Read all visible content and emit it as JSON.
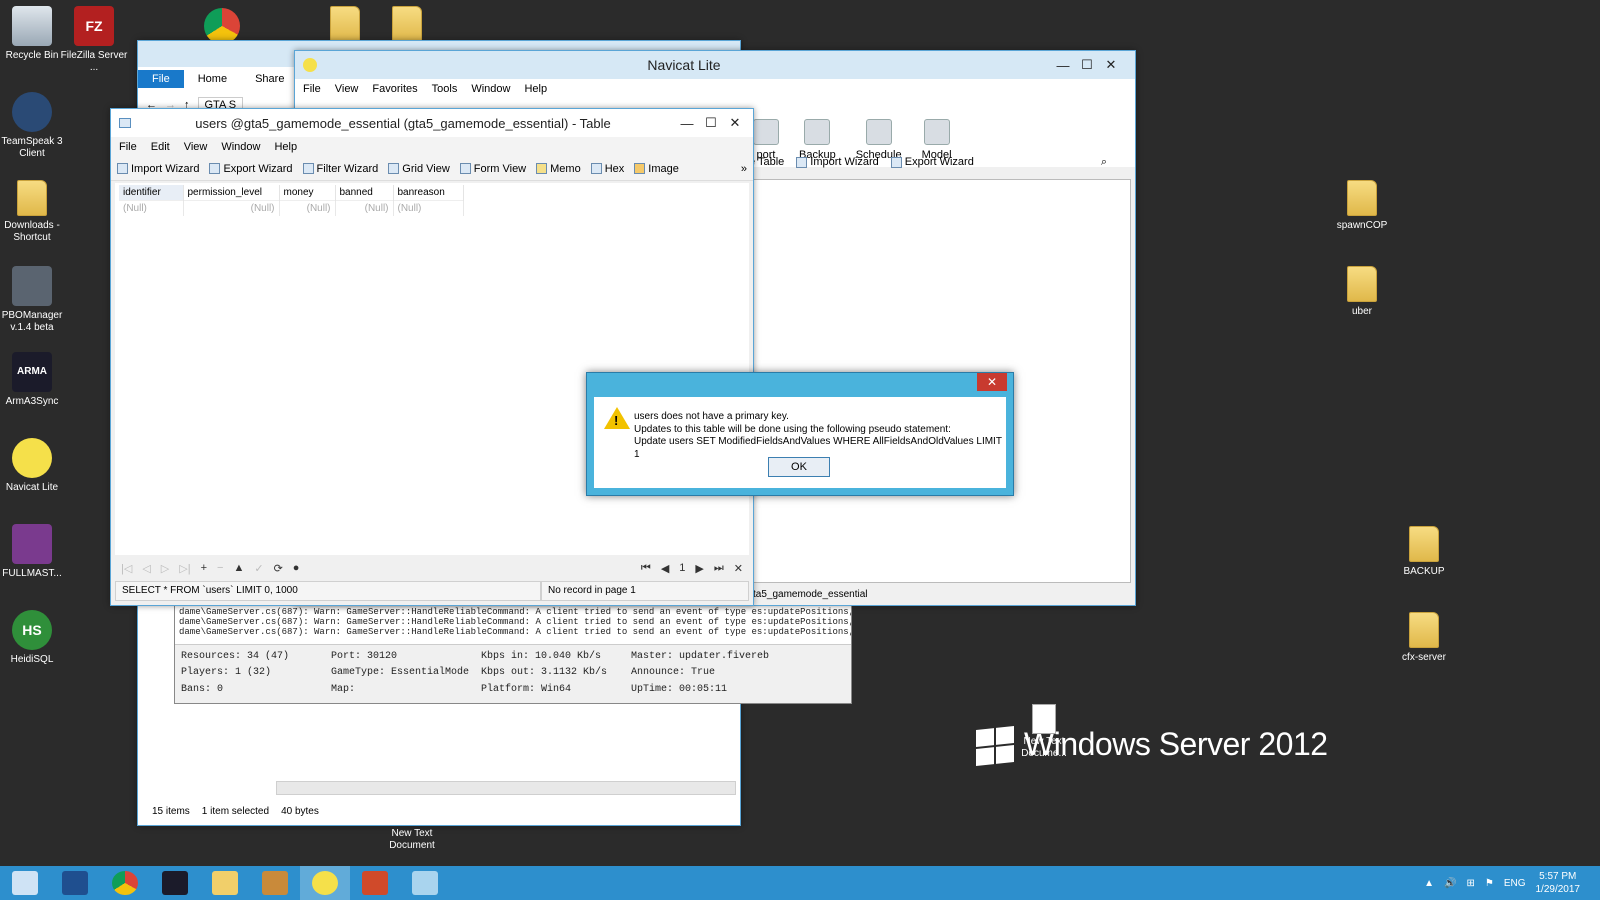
{
  "desktop": {
    "left_icons": [
      {
        "name": "recycle-bin",
        "label": "Recycle Bin"
      },
      {
        "name": "filezilla",
        "label": "FileZilla Server ..."
      },
      {
        "name": "teamspeak",
        "label": "TeamSpeak 3 Client"
      },
      {
        "name": "downloads",
        "label": "Downloads - Shortcut"
      },
      {
        "name": "pbomanager",
        "label": "PBOManager v.1.4 beta"
      },
      {
        "name": "arma3sync",
        "label": "ArmA3Sync"
      },
      {
        "name": "navicat",
        "label": "Navicat Lite"
      },
      {
        "name": "fullmast",
        "label": "FULLMAST..."
      },
      {
        "name": "heidisql",
        "label": "HeidiSQL"
      }
    ],
    "right_icons": [
      {
        "label": "spawnCOP"
      },
      {
        "label": "uber"
      },
      {
        "label": "BACKUP"
      },
      {
        "label": "cfx-server"
      }
    ],
    "new_text_doc": "New Text Document",
    "new_text_doc_2": "New Text Docume...",
    "os_watermark": "Windows Server 2012"
  },
  "explorer": {
    "tabs": [
      "File",
      "Home",
      "Share"
    ],
    "address": "GTA S",
    "status": {
      "items": "15 items",
      "selected": "1 item selected",
      "size": "40 bytes"
    }
  },
  "console": {
    "log_lines": [
      "dame\\GameServer.cs(687): Warn: GameServer::HandleReliableCommand: A client tried to send an event of type es:updatePositions, but i",
      "dame\\GameServer.cs(687): Warn: GameServer::HandleReliableCommand: A client tried to send an event of type es:updatePositions, but i",
      "dame\\GameServer.cs(687): Warn: GameServer::HandleReliableCommand: A client tried to send an event of type es:updatePositions, but i"
    ],
    "stats": [
      "Resources: 34 (47)",
      "Port: 30120",
      "Kbps in: 10.040 Kb/s",
      "Master: updater.fivereb",
      "Players: 1 (32)",
      "GameType: EssentialMode",
      "Kbps out: 3.1132 Kb/s",
      "Announce: True",
      "Bans: 0",
      "Map:",
      "Platform: Win64",
      "UpTime: 00:05:11"
    ]
  },
  "navicat": {
    "title": "Navicat Lite",
    "menu": [
      "File",
      "View",
      "Favorites",
      "Tools",
      "Window",
      "Help"
    ],
    "big_tools": [
      "port",
      "Backup",
      "Schedule",
      "Model"
    ],
    "object_toolbar": [
      "e Table",
      "Import Wizard",
      "Export Wizard"
    ],
    "status": "ta5_gamemode_essential"
  },
  "table_window": {
    "title": "users @gta5_gamemode_essential (gta5_gamemode_essential) - Table",
    "menu": [
      "File",
      "Edit",
      "View",
      "Window",
      "Help"
    ],
    "toolbar": [
      "Import Wizard",
      "Export Wizard",
      "Filter Wizard",
      "Grid View",
      "Form View",
      "Memo",
      "Hex",
      "Image"
    ],
    "columns": [
      "identifier",
      "permission_level",
      "money",
      "banned",
      "banreason"
    ],
    "row": [
      "(Null)",
      "(Null)",
      "(Null)",
      "(Null)",
      "(Null)"
    ],
    "page": "1",
    "status_sql": "SELECT * FROM `users` LIMIT 0, 1000",
    "status_record": "No record in page 1"
  },
  "dialog": {
    "line1": "users does not have a primary key.",
    "line2": "Updates to this table will be done using the following pseudo statement:",
    "line3": "Update users SET ModifiedFieldsAndValues WHERE AllFieldsAndOldValues LIMIT 1",
    "ok_label": "OK",
    "close_glyph": "✕"
  },
  "taskbar": {
    "lang": "ENG",
    "time": "5:57 PM",
    "date": "1/29/2017"
  }
}
